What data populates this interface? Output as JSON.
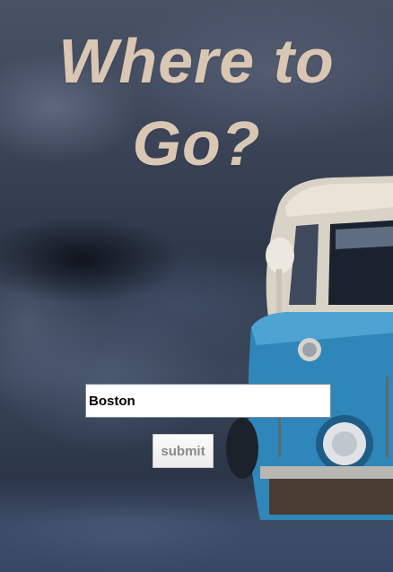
{
  "heading": {
    "line1": "Where to",
    "line2": "Go?"
  },
  "form": {
    "city_value": "Boston",
    "submit_label": "submit"
  },
  "colors": {
    "title": "#d9c7b4",
    "van_blue": "#2f86b8",
    "van_cream": "#e4ddd0"
  }
}
